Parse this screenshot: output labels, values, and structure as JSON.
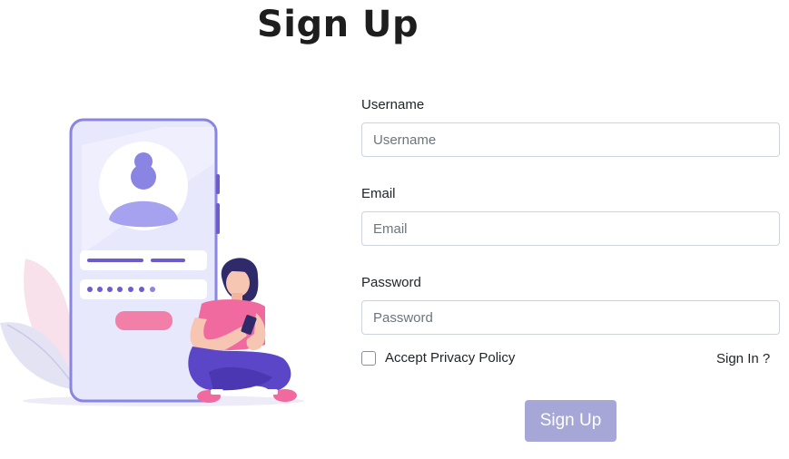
{
  "page": {
    "title": "Sign Up"
  },
  "form": {
    "username_label": "Username",
    "username_placeholder": "Username",
    "email_label": "Email",
    "email_placeholder": "Email",
    "password_label": "Password",
    "password_placeholder": "Password",
    "privacy_label": "Accept Privacy Policy",
    "privacy_checked": false,
    "signin_link": "Sign In ?",
    "submit_label": "Sign Up"
  },
  "colors": {
    "button": "#a6a7d6",
    "phone_border": "#8a84e2",
    "accent_purple": "#6d5bd0",
    "accent_pink": "#f27fa8"
  }
}
